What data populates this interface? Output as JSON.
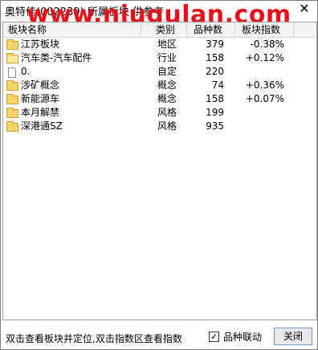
{
  "window": {
    "title": "奥特佳(002239) 所属板块 供参考",
    "close_glyph": "✕"
  },
  "watermark": "www.niugulan.com",
  "table": {
    "headers": {
      "name": "板块名称",
      "type": "类别",
      "count": "品种数",
      "index": "板块指数"
    },
    "rows": [
      {
        "icon": "folder-icon",
        "name": "江苏板块",
        "type": "地区",
        "count": "379",
        "index": "-0.38%"
      },
      {
        "icon": "folder-open-icon",
        "name": "汽车类-汽车配件",
        "type": "行业",
        "count": "158",
        "index": "+0.12%"
      },
      {
        "icon": "document-icon",
        "name": "0.",
        "type": "自定",
        "count": "220",
        "index": ""
      },
      {
        "icon": "folder-icon",
        "name": "涉矿概念",
        "type": "概念",
        "count": "74",
        "index": "+0.36%"
      },
      {
        "icon": "folder-icon",
        "name": "新能源车",
        "type": "概念",
        "count": "158",
        "index": "+0.07%"
      },
      {
        "icon": "folder-icon",
        "name": "本月解禁",
        "type": "风格",
        "count": "199",
        "index": ""
      },
      {
        "icon": "folder-icon",
        "name": "深港通SZ",
        "type": "风格",
        "count": "935",
        "index": ""
      }
    ]
  },
  "status": {
    "hint": "双击查看板块并定位,双击指数区查看指数",
    "checkbox_label": "品种联动",
    "checkbox_checked": true,
    "check_glyph": "✓",
    "close_button": "关闭"
  }
}
